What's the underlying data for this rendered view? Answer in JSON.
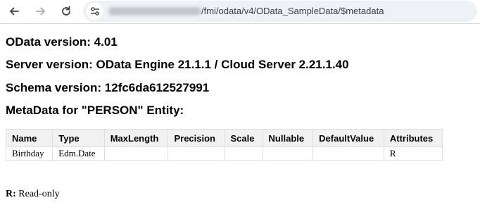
{
  "browser": {
    "url_visible": "/fmi/odata/v4/OData_SampleData/$metadata"
  },
  "info": {
    "odata_version": "OData version: 4.01",
    "server_version": "Server version: OData Engine 21.1.1 / Cloud Server 2.21.1.40",
    "schema_version": "Schema version: 12fc6da612527991",
    "metadata_title": "MetaData for \"PERSON\" Entity:"
  },
  "table": {
    "headers": [
      "Name",
      "Type",
      "MaxLength",
      "Precision",
      "Scale",
      "Nullable",
      "DefaultValue",
      "Attributes"
    ],
    "rows": [
      [
        "Birthday",
        "Edm.Date",
        "",
        "",
        "",
        "",
        "",
        "R"
      ]
    ]
  },
  "legend": {
    "key": "R:",
    "text": "Read-only"
  }
}
